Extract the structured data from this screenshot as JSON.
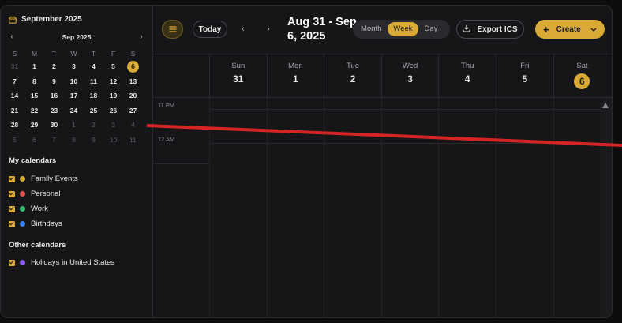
{
  "sidebar": {
    "header_title": "September 2025",
    "mini_month_label": "Sep 2025",
    "prev_glyph": "‹",
    "next_glyph": "›",
    "weekday_initials": [
      "S",
      "M",
      "T",
      "W",
      "T",
      "F",
      "S"
    ],
    "weeks": [
      [
        "31",
        "1",
        "2",
        "3",
        "4",
        "5",
        "6"
      ],
      [
        "7",
        "8",
        "9",
        "10",
        "11",
        "12",
        "13"
      ],
      [
        "14",
        "15",
        "16",
        "17",
        "18",
        "19",
        "20"
      ],
      [
        "21",
        "22",
        "23",
        "24",
        "25",
        "26",
        "27"
      ],
      [
        "28",
        "29",
        "30",
        "1",
        "2",
        "3",
        "4"
      ],
      [
        "5",
        "6",
        "7",
        "8",
        "9",
        "10",
        "11"
      ]
    ],
    "my_calendars_title": "My calendars",
    "my_calendars": [
      {
        "label": "Family Events",
        "color": "#d9aa35"
      },
      {
        "label": "Personal",
        "color": "#e05252"
      },
      {
        "label": "Work",
        "color": "#2fbf71"
      },
      {
        "label": "Birthdays",
        "color": "#3b82f6"
      }
    ],
    "other_calendars_title": "Other calendars",
    "other_calendars": [
      {
        "label": "Holidays in United States",
        "color": "#8b5cf6"
      }
    ]
  },
  "toolbar": {
    "today_label": "Today",
    "prev_glyph": "‹",
    "next_glyph": "›",
    "range_title": "Aug 31 - Sep 6, 2025",
    "views": [
      "Month",
      "Week",
      "Day"
    ],
    "active_view": "Week",
    "export_label": "Export ICS",
    "create_label": "Create"
  },
  "week_days": [
    {
      "name": "Sun",
      "num": "31"
    },
    {
      "name": "Mon",
      "num": "1"
    },
    {
      "name": "Tue",
      "num": "2"
    },
    {
      "name": "Wed",
      "num": "3"
    },
    {
      "name": "Thu",
      "num": "4"
    },
    {
      "name": "Fri",
      "num": "5"
    },
    {
      "name": "Sat",
      "num": "6"
    }
  ],
  "time_labels": [
    "11 PM",
    "12 AM"
  ],
  "colors": {
    "accent": "#d9aa35",
    "current_time_line": "#d42424"
  }
}
